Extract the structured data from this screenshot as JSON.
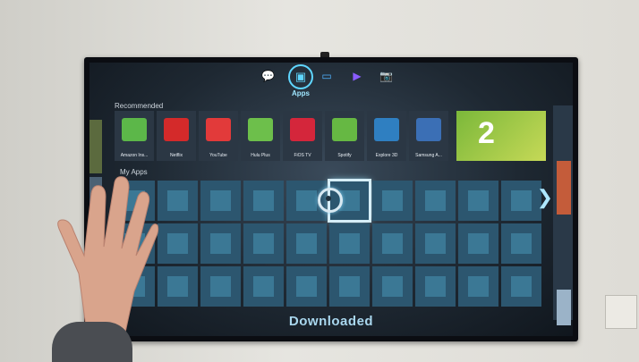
{
  "nav": {
    "items": [
      {
        "id": "social",
        "glyph": "💬",
        "color": "#e7e23c"
      },
      {
        "id": "apps",
        "glyph": "▣",
        "color": "#5fd6ff",
        "active": true,
        "label": "Apps"
      },
      {
        "id": "tv",
        "glyph": "▭",
        "color": "#4fb3ff"
      },
      {
        "id": "movies",
        "glyph": "▶",
        "color": "#8a5cff"
      },
      {
        "id": "photos",
        "glyph": "📷",
        "color": "#ff4fa8"
      }
    ]
  },
  "recommended": {
    "title": "Recommended",
    "tiles": [
      {
        "name": "Amazon Ins...",
        "color": "#5cb749"
      },
      {
        "name": "Netflix",
        "color": "#d42a2a"
      },
      {
        "name": "YouTube",
        "color": "#e23a3a"
      },
      {
        "name": "Hulu Plus",
        "color": "#6dbf4b"
      },
      {
        "name": "FiOS TV",
        "color": "#d4263b"
      },
      {
        "name": "Spotify",
        "color": "#66b843"
      },
      {
        "name": "Explore 3D",
        "color": "#2f7fc1"
      },
      {
        "name": "Samsung A...",
        "color": "#3b6fb5"
      }
    ],
    "banner_number": "2"
  },
  "my_apps": {
    "title": "My Apps",
    "rows": 3,
    "cols": 10,
    "focused_index": 5
  },
  "footer": {
    "label": "Downloaded"
  }
}
